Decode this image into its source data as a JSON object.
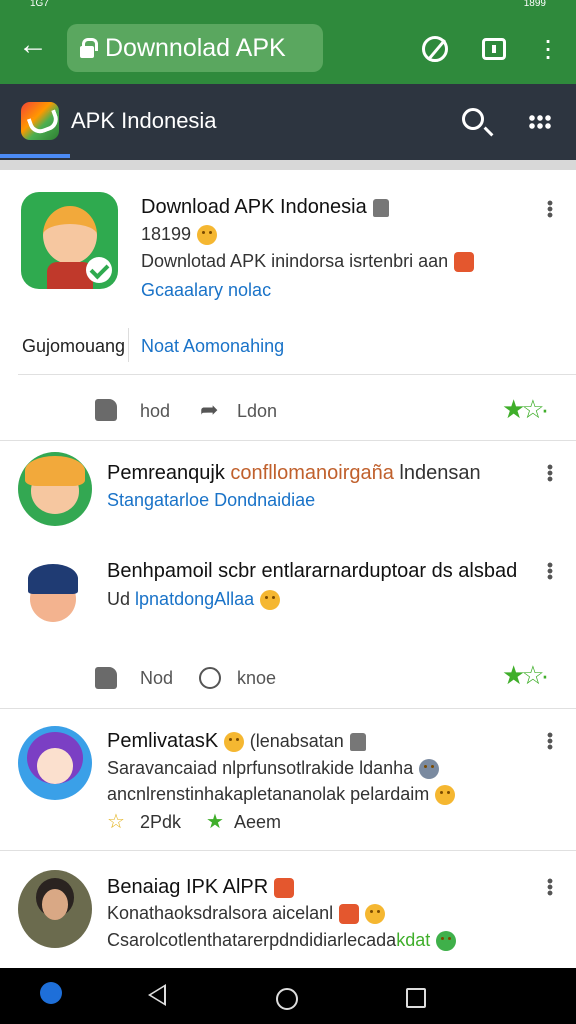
{
  "status_bar": {
    "left": "1G7",
    "right": "1899"
  },
  "browser": {
    "url_text": "Downnolad APK"
  },
  "app_bar": {
    "title": "APK Indonesia"
  },
  "post_main": {
    "title": "Download APK Indonesia",
    "count": "18199",
    "description": "Downlotad APK  inindorsa isrtenbri aan",
    "link": "Gcaaalary nolac",
    "tab_left": "Gujomouang",
    "tab_right": "Noat Aomonahing",
    "action_like": "hod",
    "action_share": "Ldon"
  },
  "posts": [
    {
      "title_a": "Pemreanqujk",
      "title_b": "confllomanoirgaña",
      "title_c": "lndensan",
      "link": "Stangatarloe Dondnaidiae"
    },
    {
      "title": "Benhpamoil scbr entlararnarduptoar ds alsbad",
      "sub_a": "Ud",
      "link": "lpnatdongAllaa",
      "action_like": "Nod",
      "action_heart": "knoe"
    },
    {
      "title": "PemlivatasK",
      "title_b": "(lenabsatan",
      "line1": "Saravancaiad nlprfunsotlrakide ldanha",
      "line2": "ancnlrenstinhakapletananolak pelardaim",
      "meta_left": "2Pdk",
      "meta_right": "Aeem"
    },
    {
      "title": "Benaiag IPK AlPR",
      "line1": "Konathaoksdralsora aicelanl",
      "line2": "Csarolcotlenthatarerpdndidiarlecada",
      "line2_tail": "kdat"
    }
  ],
  "colors": {
    "browser_bar": "#2f8a3c",
    "app_bar": "#2d3540",
    "link": "#1a73c8",
    "accent_green": "#3fae2a"
  },
  "icons": [
    "back-arrow-icon",
    "lock-icon",
    "speed-icon",
    "tab-icon",
    "more-vert-icon",
    "app-logo-icon",
    "search-icon",
    "grid-icon",
    "kebab-icon",
    "like-icon",
    "share-icon",
    "heart-icon",
    "star-icon",
    "nav-back-icon",
    "nav-home-icon",
    "nav-recent-icon"
  ]
}
